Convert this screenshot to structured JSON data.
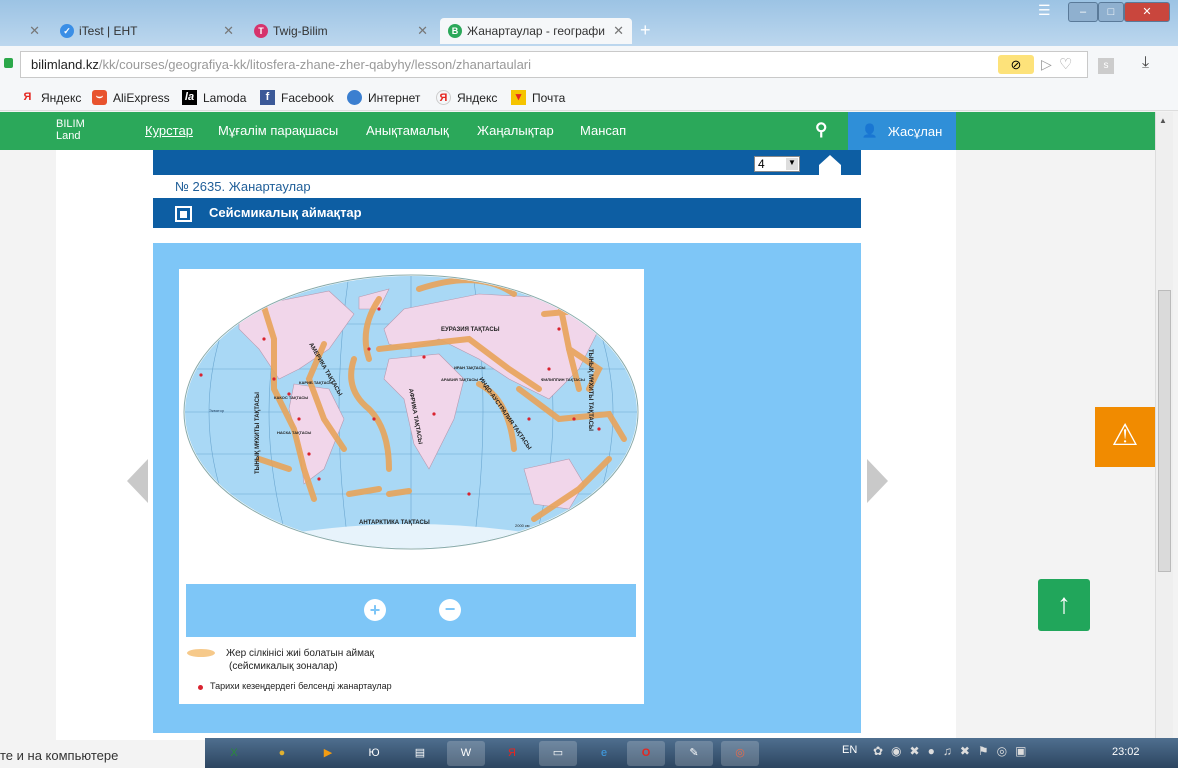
{
  "browser": {
    "tabs": [
      {
        "label": "",
        "active": false
      },
      {
        "label": "iTest | ЕНТ",
        "active": false
      },
      {
        "label": "Twig-Bilim",
        "active": false
      },
      {
        "label": "Жанартаулар - географи",
        "active": true
      }
    ],
    "url_domain": "bilimland.kz",
    "url_path": "/kk/courses/geografiya-kk/litosfera-zhane-zher-qabyhy/lesson/zhanartaulari",
    "extension_badge": "s",
    "bookmarks": [
      "Яндекс",
      "AliExpress",
      "Lamoda",
      "Facebook",
      "Интернет",
      "Яндекс",
      "Почта"
    ]
  },
  "site": {
    "logo_top": "BILIM",
    "logo_bottom": "Land",
    "nav": [
      "Курстар",
      "Мұғалім парақшасы",
      "Анықтамалық",
      "Жаңалықтар",
      "Мансап"
    ],
    "user_name": "Жасұлан",
    "page_select_value": "4",
    "lesson_title": "№ 2635. Жанартаулар",
    "section_title": "Сейсмикалық аймақтар"
  },
  "map": {
    "labels": [
      "ЕУРАЗИЯ ТАҚТАСЫ",
      "АФРИКА ТАҚТАСЫ",
      "ИНДО-АУСТРАЛИЯ ТАҚТАСЫ",
      "АНТАРКТИКА ТАҚТАСЫ",
      "АМЕРИКА ТАҚТАСЫ",
      "ТЫНЫҚ МҰХИТЫ ТАҚТАСЫ",
      "ТЫНЫҚ МҰХИТЫ ТАҚТАСЫ",
      "НАСКА ТАҚТАСЫ",
      "КАКОС ТАҚТАСЫ",
      "КАРИБ ТАҚТАСЫ",
      "ИРАН ТАҚТАСЫ",
      "АРАБИЯ ТАҚТАСЫ",
      "ФИЛИППИН ТАҚТАСЫ",
      "Экватор",
      "2000 км"
    ],
    "legend": {
      "zone_line1": "Жер сілкінісі жиі болатын аймақ",
      "zone_line2": "(сейсмикалық зоналар)",
      "volcano": "Тарихи кезеңдердегі белсенді жанартаулар"
    },
    "colors": {
      "ocean": "#a9d8f5",
      "land": "#f1d6ea",
      "seismic": "#e8a45a",
      "volcano": "#d9232f"
    }
  },
  "taskbar": {
    "left_text": "те и на компьютере",
    "lang": "EN",
    "clock": "23:02"
  }
}
